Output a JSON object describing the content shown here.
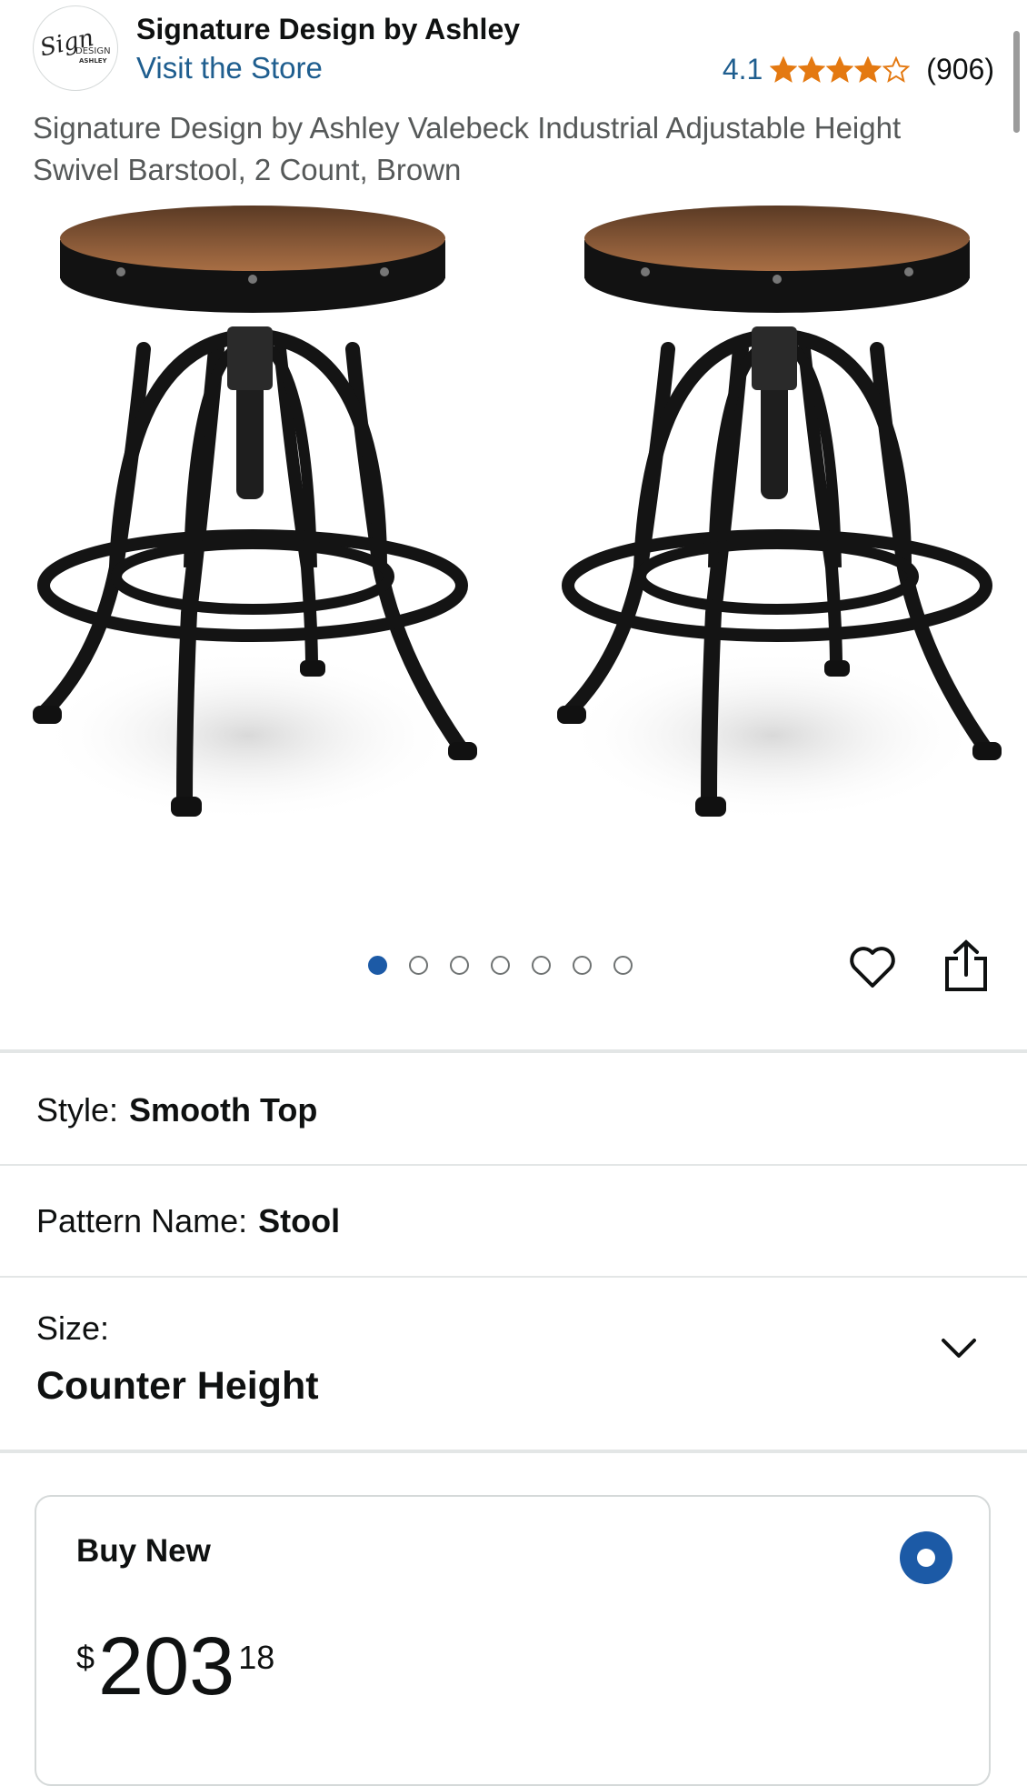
{
  "brand": {
    "name": "Signature Design by Ashley",
    "store_link": "Visit the Store",
    "logo": {
      "script": "Signature",
      "design": "DESIGN",
      "ashley": "ASHLEY"
    }
  },
  "rating": {
    "value": "4.1",
    "stars": 4.1,
    "max_stars": 5,
    "review_count": "(906)",
    "star_color": "#e47911"
  },
  "product": {
    "title": "Signature Design by Ashley Valebeck Industrial Adjustable Height Swivel Barstool, 2 Count, Brown",
    "image_subject": "two-adjustable-swivel-barstools",
    "image_count": 7,
    "active_image": 1
  },
  "actions": {
    "favorite_icon": "heart-icon",
    "share_icon": "share-icon"
  },
  "options": {
    "style": {
      "label": "Style:",
      "value": "Smooth Top"
    },
    "pattern": {
      "label": "Pattern Name:",
      "value": "Stool"
    },
    "size": {
      "label": "Size:",
      "value": "Counter Height",
      "icon": "chevron-down-icon"
    }
  },
  "buy_box": {
    "title": "Buy New",
    "selected": true,
    "price": {
      "symbol": "$",
      "whole": "203",
      "fraction": "18"
    }
  },
  "colors": {
    "link": "#1f5e8f",
    "accent": "#1c5aa6",
    "text": "#0f1111",
    "muted": "#565959"
  }
}
